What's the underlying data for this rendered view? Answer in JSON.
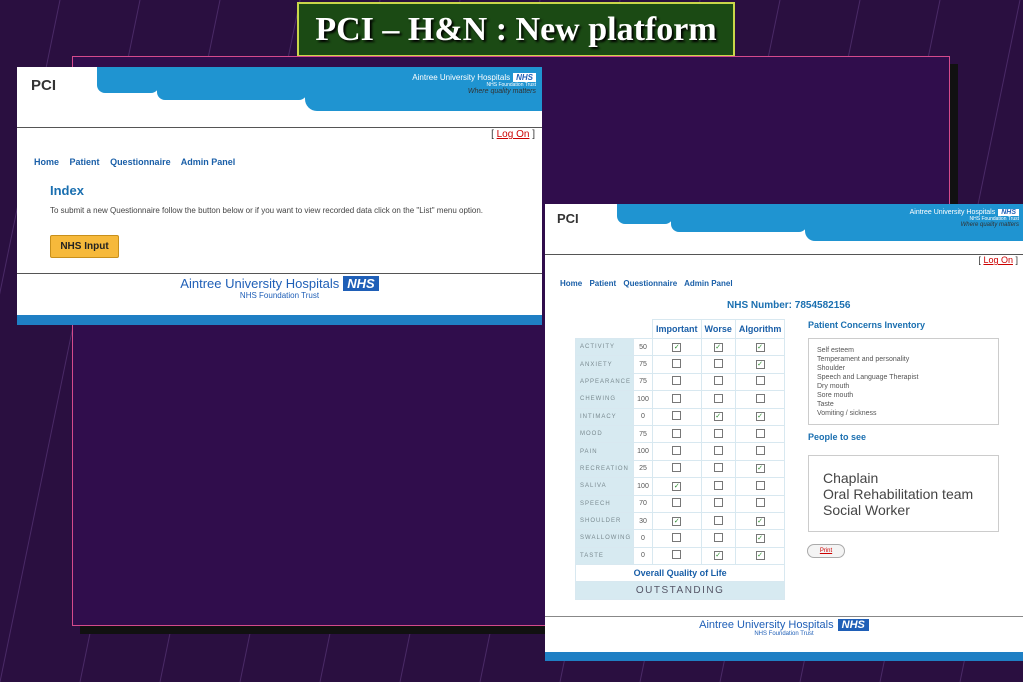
{
  "slide_title": "PCI – H&N : New platform",
  "colors": {
    "background": "#2a0f40",
    "nhs_blue": "#1f94d1",
    "title_bg": "#1b4a14",
    "frame": "#d44a8c"
  },
  "window_left": {
    "app_logo": "PCI",
    "header_org": "Aintree University Hospitals",
    "header_nhs": "NHS",
    "header_trust": "NHS Foundation Trust",
    "header_tagline": "Where quality matters",
    "logon_open": "[",
    "logon_label": "Log On",
    "logon_close": "]",
    "nav": [
      "Home",
      "Patient",
      "Questionnaire",
      "Admin Panel"
    ],
    "page_heading": "Index",
    "instruction": "To submit a new Questionnaire follow the button below or if you want to view recorded data click on the \"List\" menu option.",
    "input_button": "NHS Input",
    "footer_org": "Aintree University Hospitals",
    "footer_nhs": "NHS",
    "footer_trust": "NHS Foundation Trust"
  },
  "window_right": {
    "app_logo": "PCI",
    "header_org": "Aintree University Hospitals",
    "header_nhs": "NHS",
    "header_trust": "NHS Foundation Trust",
    "header_tagline": "Where quality matters",
    "logon_open": "[",
    "logon_label": "Log On",
    "logon_close": "]",
    "nav": [
      "Home",
      "Patient",
      "Questionnaire",
      "Admin Panel"
    ],
    "nhs_number": "NHS Number: 7854582156",
    "columns": [
      "Important",
      "Worse",
      "Algorithm"
    ],
    "rows": [
      {
        "label": "ACTIVITY",
        "value": "50",
        "important": true,
        "worse": true,
        "algorithm": true
      },
      {
        "label": "ANXIETY",
        "value": "75",
        "important": false,
        "worse": false,
        "algorithm": true
      },
      {
        "label": "APPEARANCE",
        "value": "75",
        "important": false,
        "worse": false,
        "algorithm": false
      },
      {
        "label": "CHEWING",
        "value": "100",
        "important": false,
        "worse": false,
        "algorithm": false
      },
      {
        "label": "INTIMACY",
        "value": "0",
        "important": false,
        "worse": true,
        "algorithm": true
      },
      {
        "label": "MOOD",
        "value": "75",
        "important": false,
        "worse": false,
        "algorithm": false
      },
      {
        "label": "PAIN",
        "value": "100",
        "important": false,
        "worse": false,
        "algorithm": false
      },
      {
        "label": "RECREATION",
        "value": "25",
        "important": false,
        "worse": false,
        "algorithm": true
      },
      {
        "label": "SALIVA",
        "value": "100",
        "important": true,
        "worse": false,
        "algorithm": false
      },
      {
        "label": "SPEECH",
        "value": "70",
        "important": false,
        "worse": false,
        "algorithm": false
      },
      {
        "label": "SHOULDER",
        "value": "30",
        "important": true,
        "worse": false,
        "algorithm": true
      },
      {
        "label": "SWALLOWING",
        "value": "0",
        "important": false,
        "worse": false,
        "algorithm": true
      },
      {
        "label": "TASTE",
        "value": "0",
        "important": false,
        "worse": true,
        "algorithm": true
      }
    ],
    "overall_label": "Overall Quality of Life",
    "overall_value": "OUTSTANDING",
    "concerns_heading": "Patient Concerns Inventory",
    "concerns": [
      "Self esteem",
      "Temperament and personality",
      "Shoulder",
      "Speech and Language Therapist",
      "Dry mouth",
      "Sore mouth",
      "Taste",
      "Vomiting / sickness"
    ],
    "people_heading": "People to see",
    "people": [
      "Chaplain",
      "Oral Rehabilitation team",
      "Social Worker"
    ],
    "print_button": "Print",
    "footer_org": "Aintree University Hospitals",
    "footer_nhs": "NHS",
    "footer_trust": "NHS Foundation Trust"
  }
}
